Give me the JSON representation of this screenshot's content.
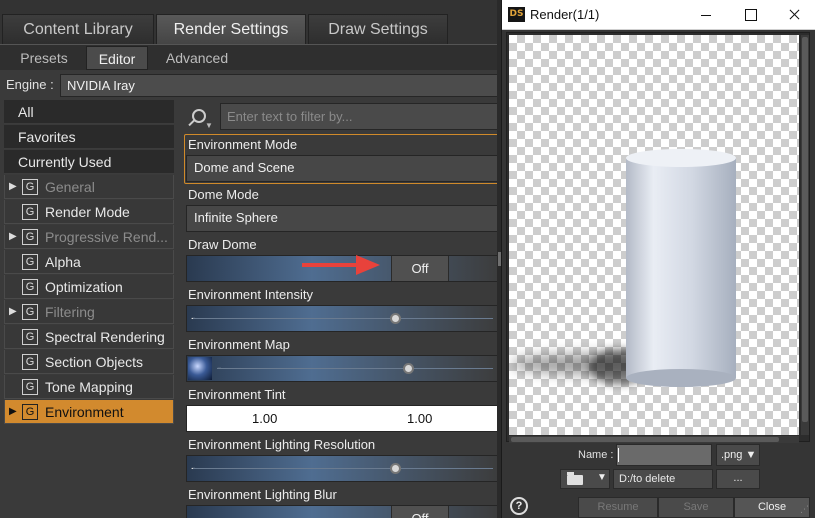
{
  "main_tabs": [
    "Content Library",
    "Render Settings",
    "Draw Settings"
  ],
  "sub_tabs": [
    "Presets",
    "Editor",
    "Advanced"
  ],
  "engine": {
    "label": "Engine :",
    "value": "NVIDIA Iray"
  },
  "filter_placeholder": "Enter text to filter by...",
  "categories": [
    {
      "label": "All"
    },
    {
      "label": "Favorites"
    },
    {
      "label": "Currently Used"
    },
    {
      "label": "General",
      "expandable": true,
      "dim": true
    },
    {
      "label": "Render Mode"
    },
    {
      "label": "Progressive Rend...",
      "expandable": true,
      "dim": true
    },
    {
      "label": "Alpha"
    },
    {
      "label": "Optimization"
    },
    {
      "label": "Filtering",
      "expandable": true,
      "dim": true
    },
    {
      "label": "Spectral Rendering"
    },
    {
      "label": "Section Objects"
    },
    {
      "label": "Tone Mapping"
    },
    {
      "label": "Environment",
      "expandable": true,
      "active": true
    }
  ],
  "group_icon_letter": "G",
  "properties": {
    "environment_mode": {
      "label": "Environment Mode",
      "value": "Dome and Scene"
    },
    "dome_mode": {
      "label": "Dome Mode",
      "value": "Infinite Sphere"
    },
    "draw_dome": {
      "label": "Draw Dome",
      "value": "Off"
    },
    "environment_intensity": {
      "label": "Environment Intensity",
      "level": 0.67
    },
    "environment_map": {
      "label": "Environment Map",
      "level": 0.71
    },
    "environment_tint": {
      "label": "Environment Tint",
      "values": [
        "1.00",
        "1.00"
      ]
    },
    "environment_lighting_resolution": {
      "label": "Environment Lighting Resolution",
      "level": 0.67
    },
    "environment_lighting_blur": {
      "label": "Environment Lighting Blur",
      "value": "Off"
    }
  },
  "render_window": {
    "title": "Render(1/1)",
    "logo": "DS",
    "name_label": "Name :",
    "name_value": "",
    "extension": ".png ▼",
    "folder_caret": "▼",
    "path": "D:/to delete",
    "browse": "...",
    "help": "?",
    "buttons": [
      "Resume",
      "Save",
      "Close"
    ]
  },
  "colors": {
    "accent_orange": "#d28a2e",
    "arrow_red": "#e8423b",
    "panel_bg": "#3a3a3a"
  },
  "icons": [
    "search-icon",
    "filter-chevron-icon",
    "expand-triangle-icon",
    "group-icon",
    "folder-icon",
    "help-icon",
    "minimize-icon",
    "maximize-icon",
    "close-icon"
  ]
}
